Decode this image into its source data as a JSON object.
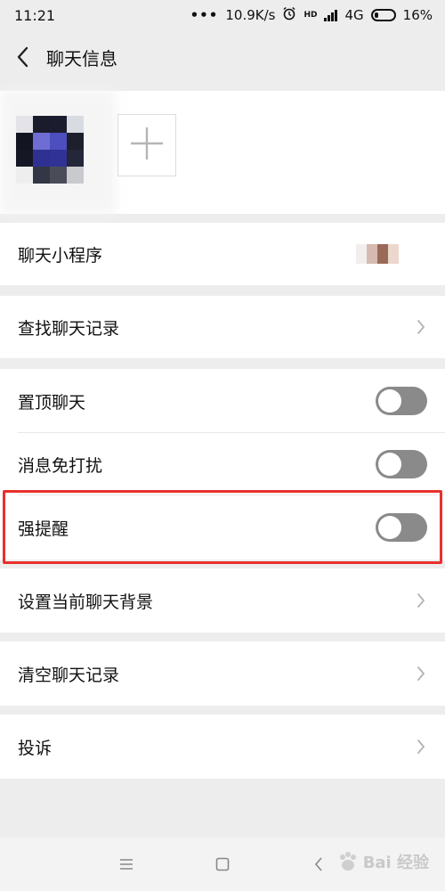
{
  "status_bar": {
    "time": "11:21",
    "dots": "•••",
    "network_speed": "10.9K/s",
    "alarm_icon": "alarm-icon",
    "hd_badge": "HD",
    "network_type": "4G",
    "battery": "16%"
  },
  "header": {
    "back_icon": "chevron-left-icon",
    "title": "聊天信息"
  },
  "members": {
    "avatar_icon": "pixelated-avatar",
    "add_icon": "plus-icon"
  },
  "rows": {
    "mini_programs": "聊天小程序",
    "search_history": "查找聊天记录",
    "pin_chat": "置顶聊天",
    "mute": "消息免打扰",
    "strong_reminder": "强提醒",
    "chat_background": "设置当前聊天背景",
    "clear_history": "清空聊天记录",
    "complain": "投诉"
  },
  "toggles": {
    "pin_chat": false,
    "mute": false,
    "strong_reminder": false
  },
  "nav_bar": {
    "menu_icon": "menu-icon",
    "home_icon": "square-home-icon",
    "back_icon": "back-arrow-icon"
  },
  "watermark": {
    "text": "Bai 经验"
  },
  "colors": {
    "highlight": "#e8302c",
    "toggle_off": "#8a8a8a",
    "background": "#ededed"
  }
}
